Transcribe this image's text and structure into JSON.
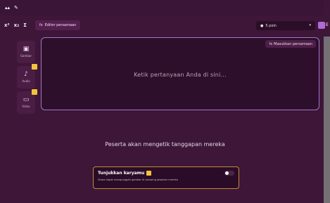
{
  "topbar": {
    "icon_1": "signal-icon",
    "icon_2": "pen-icon"
  },
  "toolbar": {
    "superscript": "x²",
    "subscript": "x₂",
    "sigma": "Σ",
    "equation_icon": "fx",
    "equation_label": "Editor persamaan"
  },
  "points": {
    "value": "5 poin",
    "icon": "circle-icon"
  },
  "media": [
    {
      "label": "Gambar",
      "icon": "image-icon"
    },
    {
      "label": "Audio",
      "icon": "mic-icon"
    },
    {
      "label": "Video",
      "icon": "video-icon"
    }
  ],
  "editor": {
    "show_equation_label": "Masukkan persamaan",
    "equation_icon": "fx",
    "placeholder": "Ketik pertanyaan Anda di sini..."
  },
  "response_text": "Peserta akan mengetik tanggapan mereka",
  "show_work": {
    "title": "Tunjukkan karyamu",
    "description": "Siswa dapat mengunggah gambar di samping jawaban mereka",
    "enabled": false
  },
  "colors": {
    "background": "#3d1638",
    "editor_border": "#9f77c4",
    "badge": "#f3c33b",
    "show_work_border": "#c48a36"
  }
}
